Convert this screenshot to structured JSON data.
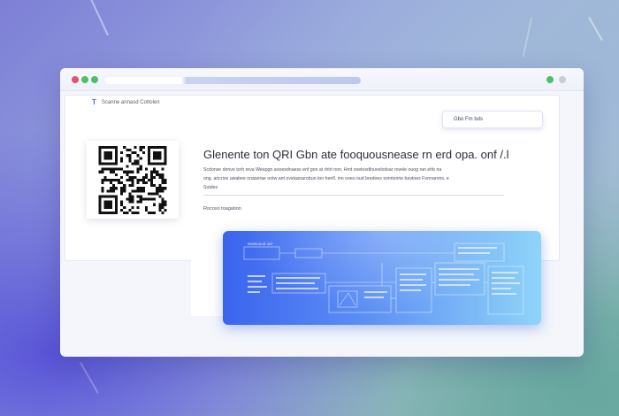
{
  "window": {
    "dots": [
      "#e0556b",
      "#48c268",
      "#48c268"
    ],
    "right_dots": [
      "#48c268",
      "#c8ccd6"
    ]
  },
  "brand": {
    "logo": "T",
    "name": "Scanne annasd Cottolen"
  },
  "main": {
    "heading": "Glenente ton QRI Gbn ate  fooquousnease rn erd opa. onf /.l",
    "description_lines": [
      "Scdonse donve torh reva  Weapgn aooesdnaess enf gon at rhtrt non. Hmt ovetosdlnuvelodsar rovele  ouog ran ehb na",
      "ong. aricrios uwabee onaserae ootw ant ovstasnarobuo ton henfl. ino ooeu oud bredoes sonrionne bavtoes  Fonnarons. e",
      "Sutdes"
    ],
    "subheading": "Rocoso toagation"
  },
  "generate_button": {
    "label": "Gbo Fm bds"
  },
  "preview": {
    "label": "Sonsonod ont’"
  }
}
